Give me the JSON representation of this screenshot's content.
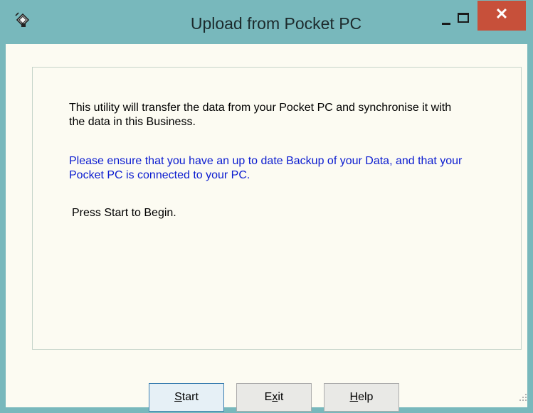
{
  "window": {
    "title": "Upload from Pocket PC",
    "close_glyph": "✕",
    "colors": {
      "frame": "#78b8bc",
      "close": "#c7503a",
      "client": "#fcfbf2",
      "info_text": "#0a1bd0"
    }
  },
  "message": {
    "intro": "This utility will transfer the data from your Pocket PC and synchronise it with the data in this Business.",
    "warning": "Please ensure that you have an up to date Backup of your Data, and that your Pocket PC is connected to your PC.",
    "prompt": "Press Start to Begin."
  },
  "buttons": {
    "start": {
      "mnemonic": "S",
      "rest": "tart"
    },
    "exit": {
      "pre": "E",
      "mnemonic": "x",
      "rest": "it"
    },
    "help": {
      "mnemonic": "H",
      "rest": "elp"
    }
  },
  "icons": [
    "app-icon",
    "minimize-icon",
    "maximize-icon",
    "close-icon",
    "resize-grip-icon"
  ]
}
